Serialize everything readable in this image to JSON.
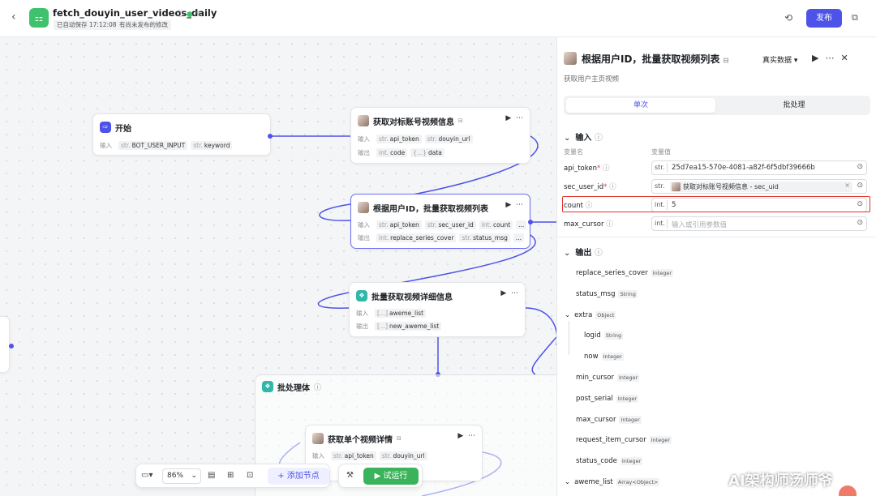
{
  "header": {
    "back_icon": "chevron-left-icon",
    "app_icon": "workflow-icon",
    "title": "fetch_douyin_user_videos_daily",
    "autosave": "已自动保存 17:12:08",
    "unpublished": "有尚未发布的修改",
    "publish_label": "发布",
    "accent": "#4d53e8"
  },
  "nodes": {
    "start": {
      "title": "开始",
      "in_label": "输入",
      "inputs": [
        {
          "type": "str.",
          "name": "BOT_USER_INPUT"
        },
        {
          "type": "str.",
          "name": "keyword"
        }
      ]
    },
    "get_info": {
      "title": "获取对标账号视频信息",
      "in_label": "输入",
      "out_label": "输出",
      "inputs": [
        {
          "type": "str.",
          "name": "api_token"
        },
        {
          "type": "str.",
          "name": "douyin_url"
        }
      ],
      "outputs": [
        {
          "type": "int.",
          "name": "code"
        },
        {
          "type": "{...}",
          "name": "data"
        }
      ]
    },
    "batch_list": {
      "title": "根据用户ID，批量获取视频列表",
      "in_label": "输入",
      "out_label": "输出",
      "inputs": [
        {
          "type": "str.",
          "name": "api_token"
        },
        {
          "type": "str.",
          "name": "sec_user_id"
        },
        {
          "type": "int.",
          "name": "count"
        }
      ],
      "outputs": [
        {
          "type": "int.",
          "name": "replace_series_cover"
        },
        {
          "type": "str.",
          "name": "status_msg"
        }
      ],
      "more": "..."
    },
    "batch_detail": {
      "title": "批量获取视频详细信息",
      "in_label": "输入",
      "out_label": "输出",
      "inputs": [
        {
          "type": "[...]",
          "name": "aweme_list"
        }
      ],
      "outputs": [
        {
          "type": "[...]",
          "name": "new_aweme_list"
        }
      ]
    },
    "loop": {
      "title": "批处理体"
    },
    "single_detail": {
      "title": "获取单个视频详情",
      "in_label": "输入",
      "inputs": [
        {
          "type": "str.",
          "name": "api_token"
        },
        {
          "type": "str.",
          "name": "douyin_url"
        }
      ]
    }
  },
  "toolbar": {
    "zoom": "86%",
    "add_node": "+ 添加节点",
    "run": "▶ 试运行"
  },
  "panel": {
    "title": "根据用户ID，批量获取视频列表",
    "subtitle": "获取用户主页视频",
    "mode": "真实数据 ▾",
    "tabs": [
      "单次",
      "批处理"
    ],
    "input_section": "输入",
    "col_name": "变量名",
    "col_value": "变量值",
    "inputs": [
      {
        "name": "api_token",
        "required": true,
        "type": "str.",
        "value": "25d7ea15-570e-4081-a82f-6f5dbf39666b"
      },
      {
        "name": "sec_user_id",
        "required": true,
        "type": "str.",
        "ref": "获取对标账号视频信息 - sec_uid"
      },
      {
        "name": "count",
        "required": false,
        "type": "int.",
        "value": "5"
      },
      {
        "name": "max_cursor",
        "required": false,
        "type": "int.",
        "placeholder": "输入或引用参数值"
      }
    ],
    "output_section": "输出",
    "outputs": [
      {
        "name": "replace_series_cover",
        "type": "Integer",
        "indent": 0
      },
      {
        "name": "status_msg",
        "type": "String",
        "indent": 0
      },
      {
        "name": "extra",
        "type": "Object",
        "indent": 0,
        "expanded": true
      },
      {
        "name": "logid",
        "type": "String",
        "indent": 1
      },
      {
        "name": "now",
        "type": "Integer",
        "indent": 1
      },
      {
        "name": "min_cursor",
        "type": "Integer",
        "indent": 0
      },
      {
        "name": "post_serial",
        "type": "Integer",
        "indent": 0
      },
      {
        "name": "max_cursor",
        "type": "Integer",
        "indent": 0
      },
      {
        "name": "request_item_cursor",
        "type": "Integer",
        "indent": 0
      },
      {
        "name": "status_code",
        "type": "Integer",
        "indent": 0
      },
      {
        "name": "aweme_list",
        "type": "Array<Object>",
        "indent": 0,
        "expanded": true
      }
    ]
  },
  "watermark": "AI架构师汤师爷",
  "highlight_color": "#e0342b"
}
